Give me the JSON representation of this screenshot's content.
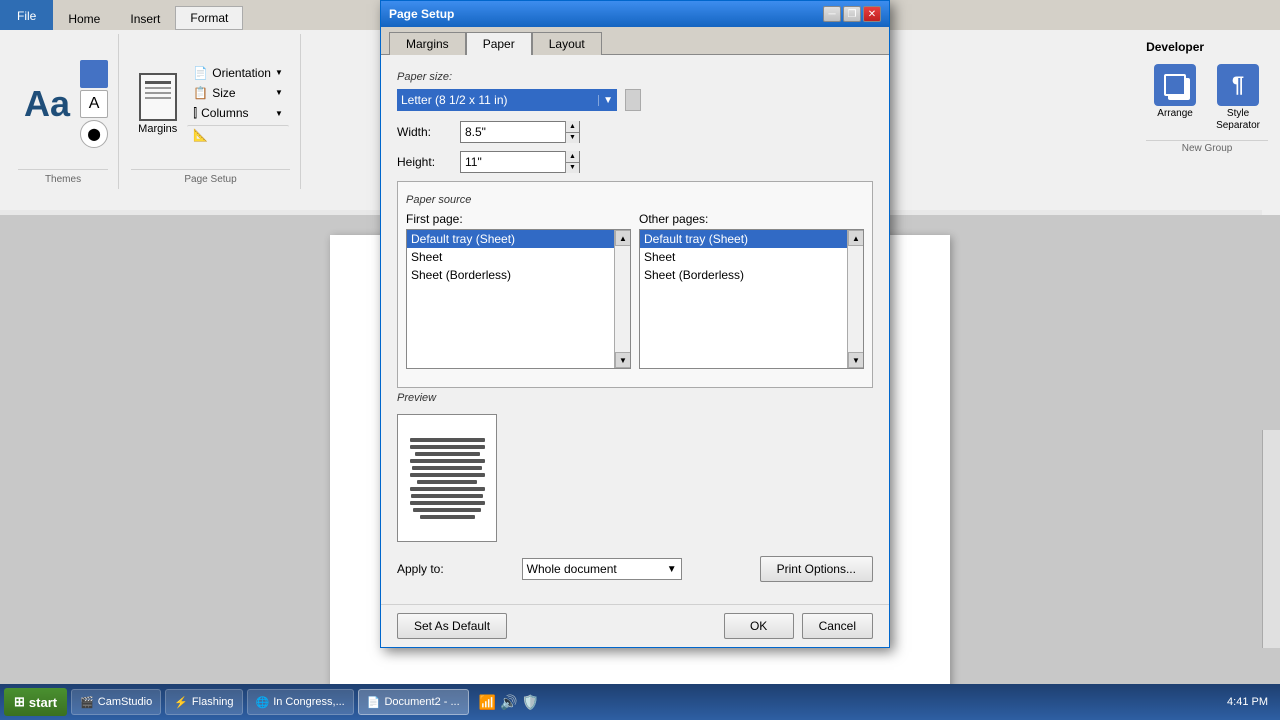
{
  "ribbon": {
    "tabs": [
      {
        "id": "file",
        "label": "File",
        "active": false,
        "is_file": true
      },
      {
        "id": "home",
        "label": "Home",
        "active": false
      },
      {
        "id": "insert",
        "label": "Insert",
        "active": false
      },
      {
        "id": "format",
        "label": "Format",
        "active": true
      },
      {
        "id": "more",
        "label": "▸",
        "active": false
      }
    ],
    "groups": {
      "themes": {
        "label": "Themes",
        "buttons": [
          "Themes"
        ]
      },
      "page_setup": {
        "label": "Page Setup",
        "buttons": [
          "Margins",
          "Orientation",
          "Size",
          "Columns"
        ]
      },
      "developer": {
        "label": "Developer"
      }
    }
  },
  "dialog": {
    "title": "Page Setup",
    "tabs": [
      {
        "id": "margins",
        "label": "Margins",
        "active": false
      },
      {
        "id": "paper",
        "label": "Paper",
        "active": true
      },
      {
        "id": "layout",
        "label": "Layout",
        "active": false
      }
    ],
    "paper_size_label": "Paper size:",
    "paper_size_value": "Letter (8 1/2 x 11 in)",
    "width_label": "Width:",
    "width_value": "8.5\"",
    "height_label": "Height:",
    "height_value": "11\"",
    "paper_source_label": "Paper source",
    "first_page_label": "First page:",
    "other_pages_label": "Other pages:",
    "first_page_items": [
      {
        "label": "Default tray (Sheet)",
        "selected": true
      },
      {
        "label": "Sheet",
        "selected": false
      },
      {
        "label": "Sheet (Borderless)",
        "selected": false
      }
    ],
    "other_page_items": [
      {
        "label": "Default tray (Sheet)",
        "selected": true
      },
      {
        "label": "Sheet",
        "selected": false
      },
      {
        "label": "Sheet (Borderless)",
        "selected": false
      }
    ],
    "preview_label": "Preview",
    "apply_to_label": "Apply to:",
    "apply_to_value": "Whole document",
    "print_options_btn": "Print Options...",
    "set_default_btn": "Set As Default",
    "ok_btn": "OK",
    "cancel_btn": "Cancel"
  },
  "developer_section": {
    "label": "Developer",
    "arrange_label": "Arrange",
    "style_separator_label": "Style\nSeparator",
    "new_group_label": "New Group"
  },
  "taskbar": {
    "start_label": "start",
    "items": [
      {
        "label": "CamStudio",
        "icon": "🎬"
      },
      {
        "label": "Flashing",
        "icon": "⚡"
      },
      {
        "label": "In Congress,...",
        "icon": "🌐"
      },
      {
        "label": "Document2 - ...",
        "icon": "📄"
      }
    ],
    "clock": "4:41 PM"
  },
  "icons": {
    "minimize": "─",
    "restore": "❐",
    "close": "✕",
    "spinner_up": "▲",
    "spinner_down": "▼",
    "scroll_up": "▲",
    "scroll_down": "▼",
    "dropdown_arrow": "▼"
  }
}
